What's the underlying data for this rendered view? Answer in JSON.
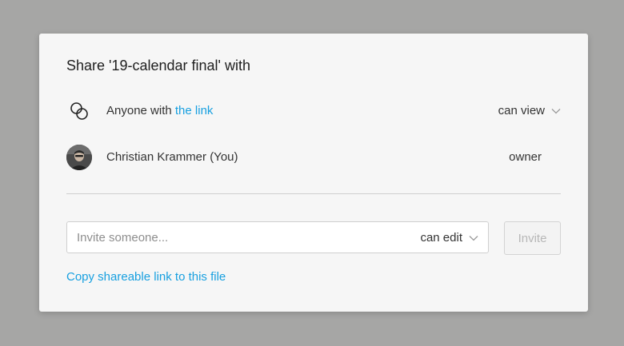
{
  "dialog": {
    "title": "Share '19-calendar final' with",
    "link_row": {
      "icon": "link-icon",
      "prefix": "Anyone with ",
      "link_text": "the link",
      "permission": "can view",
      "permission_icon": "chevron-down-icon"
    },
    "user_row": {
      "avatar": "avatar",
      "name": "Christian Krammer (You)",
      "role": "owner"
    },
    "invite": {
      "placeholder": "Invite someone...",
      "value": "",
      "permission": "can edit",
      "permission_icon": "chevron-down-icon",
      "button_label": "Invite"
    },
    "copy_link_label": "Copy shareable link to this file"
  },
  "colors": {
    "backdrop": "#a6a6a5",
    "dialog_bg": "#f6f6f6",
    "accent": "#18a0e0",
    "text": "#333333"
  }
}
